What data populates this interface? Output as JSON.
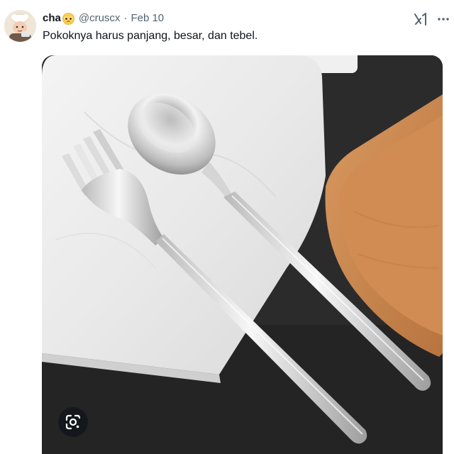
{
  "tweet": {
    "display_name": "cha",
    "name_emoji": "pleading-face-emoji",
    "handle": "@cruscx",
    "separator": "·",
    "date": "Feb 10",
    "text": "Pokoknya harus panjang, besar, dan tebel."
  },
  "icons": {
    "grok": "grok-icon",
    "more": "more-options-icon",
    "lens": "google-lens-icon"
  },
  "media": {
    "subject": "stainless steel fork and spoon"
  },
  "colors": {
    "text_primary": "#0f1419",
    "text_secondary": "#536471",
    "media_background": "#2a2a2b",
    "wood_tray": "#c98a54"
  }
}
